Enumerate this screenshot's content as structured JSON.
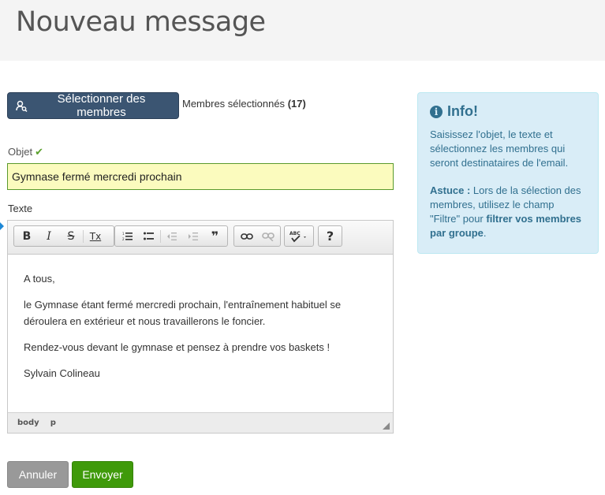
{
  "header": {
    "title": "Nouveau message"
  },
  "members": {
    "select_button": "Sélectionner des membres",
    "selected_label": "Membres sélectionnés",
    "selected_count": "(17)"
  },
  "form": {
    "subject_label": "Objet",
    "subject_value": "Gymnase fermé mercredi prochain",
    "text_label": "Texte"
  },
  "editor": {
    "toolbar": {
      "bold": "B",
      "italic": "I",
      "strike": "S",
      "clear_format": "Tx",
      "blockquote": "❞",
      "help": "?"
    },
    "content": {
      "p1": "A tous,",
      "p2": "le Gymnase étant fermé mercredi prochain, l'entraînement habituel se déroulera en extérieur et nous travaillerons le foncier.",
      "p3": "Rendez-vous devant le gymnase et pensez à prendre vos baskets !",
      "p4": "Sylvain Colineau"
    },
    "status_path": [
      "body",
      "p"
    ]
  },
  "actions": {
    "cancel": "Annuler",
    "send": "Envoyer"
  },
  "info": {
    "title": "Info!",
    "text1": "Saisissez l'objet, le texte et sélectionnez les membres qui seront destinataires de l'email.",
    "tip_label": "Astuce :",
    "tip_text_a": " Lors de la sélection des membres, utilisez le champ \"Filtre\" pour ",
    "tip_bold": "filtrer vos membres par groupe",
    "tip_end": "."
  },
  "colors": {
    "header_bg": "#f4f4f4",
    "select_button": "#3b5572",
    "subject_bg": "#fbfbbe",
    "cancel_button": "#999999",
    "send_button": "#3f9a0a",
    "info_bg": "#d9edf7",
    "info_text": "#31708f"
  },
  "icons": {
    "select_button": "user-search-icon",
    "subject_valid": "check-icon",
    "info": "info-circle-icon"
  }
}
